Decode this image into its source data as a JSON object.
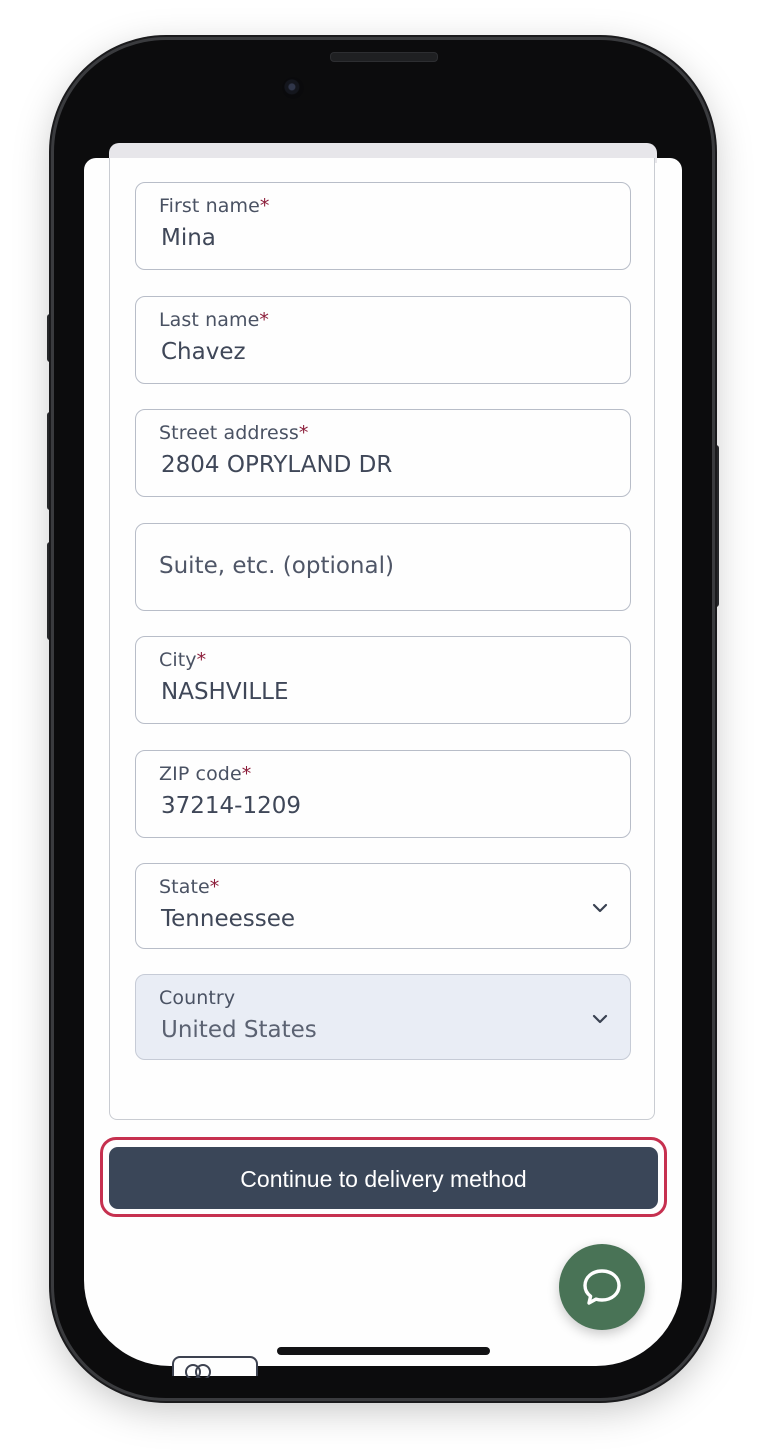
{
  "form": {
    "required_marker": "*",
    "fields": [
      {
        "label": "First name",
        "value": "Mina"
      },
      {
        "label": "Last name",
        "value": "Chavez"
      },
      {
        "label": "Street address",
        "value": "2804 OPRYLAND DR"
      },
      {
        "label": "",
        "placeholder": "Suite, etc. (optional)"
      },
      {
        "label": "City",
        "value": "NASHVILLE"
      },
      {
        "label": "ZIP code",
        "value": "37214-1209"
      },
      {
        "label": "State",
        "value": "Tenneessee"
      },
      {
        "label": "Country",
        "value": "United States"
      }
    ]
  },
  "actions": {
    "continue_label": "Continue to delivery method"
  },
  "icons": {
    "chat": "chat-bubble-icon",
    "state_dropdown": "chevron-down-icon",
    "country_dropdown": "chevron-down-icon"
  },
  "colors": {
    "primary_button": "#3a4658",
    "highlight_ring": "#c6304f",
    "chat_button": "#497356",
    "required_marker": "#8c1d3a",
    "disabled_field": "#e9edf5"
  }
}
